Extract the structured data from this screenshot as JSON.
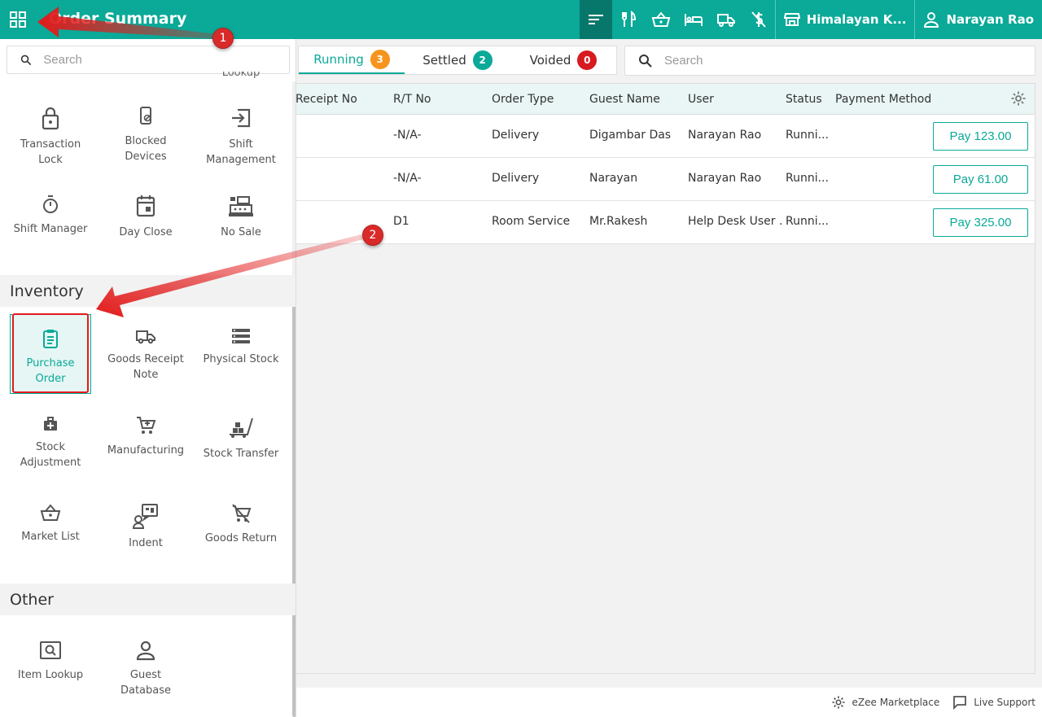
{
  "header": {
    "title": "Order Summary",
    "outlet": "Himalayan K...",
    "user": "Narayan Rao",
    "icons": [
      "sort-icon",
      "restaurant-icon",
      "basket-icon",
      "bed-icon",
      "truck-icon",
      "no-charge-icon",
      "store-icon",
      "person-icon"
    ],
    "accent_color": "#0aa998"
  },
  "tabs": [
    {
      "label": "Running",
      "count": "3",
      "color": "#f7941d"
    },
    {
      "label": "Settled",
      "count": "2",
      "color": "#0aa998"
    },
    {
      "label": "Voided",
      "count": "0",
      "color": "#d71920"
    }
  ],
  "search": {
    "placeholder": "Search"
  },
  "table": {
    "columns": [
      "Receipt No",
      "R/T No",
      "Order Type",
      "Guest Name",
      "User",
      "Status",
      "Payment Method"
    ],
    "rows": [
      {
        "receipt": "",
        "rt": "-N/A-",
        "type": "Delivery",
        "guest": "Digambar Das",
        "user": "Narayan Rao",
        "status": "Runni...",
        "payment": "",
        "pay": "Pay 123.00"
      },
      {
        "receipt": "",
        "rt": "-N/A-",
        "type": "Delivery",
        "guest": "Narayan",
        "user": "Narayan Rao",
        "status": "Runni...",
        "payment": "",
        "pay": "Pay 61.00"
      },
      {
        "receipt": "",
        "rt": "D1",
        "type": "Room Service",
        "guest": "Mr.Rakesh",
        "user": "Help Desk User ...",
        "status": "Runni...",
        "payment": "",
        "pay": "Pay 325.00"
      }
    ]
  },
  "panel": {
    "search_placeholder": "Search",
    "cutoff_label": "Lookup",
    "top_items": [
      {
        "label": "Transaction Lock",
        "icon": "lock-icon"
      },
      {
        "label": "Blocked Devices",
        "icon": "blocked-device-icon"
      },
      {
        "label": "Shift Management",
        "icon": "login-icon"
      },
      {
        "label": "Shift Manager",
        "icon": "timer-icon"
      },
      {
        "label": "Day Close",
        "icon": "calendar-icon"
      },
      {
        "label": "No Sale",
        "icon": "cash-register-icon"
      }
    ],
    "inventory_title": "Inventory",
    "inventory_items": [
      {
        "label": "Purchase Order",
        "icon": "clipboard-icon"
      },
      {
        "label": "Goods Receipt Note",
        "icon": "truck-icon"
      },
      {
        "label": "Physical Stock",
        "icon": "storage-icon"
      },
      {
        "label": "Stock Adjustment",
        "icon": "medkit-icon"
      },
      {
        "label": "Manufacturing",
        "icon": "cart-add-icon"
      },
      {
        "label": "Stock Transfer",
        "icon": "hand-truck-icon"
      },
      {
        "label": "Market List",
        "icon": "basket-icon"
      },
      {
        "label": "Indent",
        "icon": "chat-person-icon"
      },
      {
        "label": "Goods Return",
        "icon": "cart-off-icon"
      }
    ],
    "other_title": "Other",
    "other_items": [
      {
        "label": "Item Lookup",
        "icon": "image-search-icon"
      },
      {
        "label": "Guest Database",
        "icon": "person-icon"
      }
    ]
  },
  "footer": {
    "marketplace": "eZee Marketplace",
    "support": "Live Support"
  },
  "annotations": {
    "step1": "1",
    "step2": "2",
    "color": "#e21b1b"
  }
}
